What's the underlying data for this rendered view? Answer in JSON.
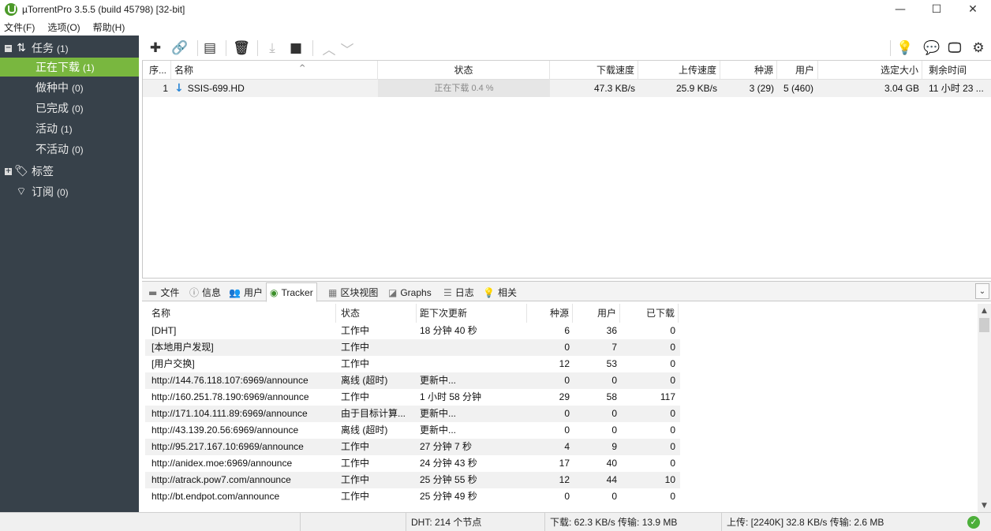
{
  "window": {
    "title": "µTorrentPro 3.5.5  (build 45798) [32-bit]",
    "minimize_icon": "minimize-icon",
    "maximize_icon": "maximize-icon",
    "close_icon": "close-icon"
  },
  "menu": [
    "文件(F)",
    "选项(O)",
    "帮助(H)"
  ],
  "sidebar": {
    "tasks": {
      "label": "任务",
      "count": "(1)"
    },
    "items": [
      {
        "label": "正在下载",
        "count": "(1)"
      },
      {
        "label": "做种中",
        "count": "(0)"
      },
      {
        "label": "已完成",
        "count": "(0)"
      },
      {
        "label": "活动",
        "count": "(1)"
      },
      {
        "label": "不活动",
        "count": "(0)"
      }
    ],
    "labels": {
      "label": "标签"
    },
    "feeds": {
      "label": "订阅",
      "count": "(0)"
    }
  },
  "toolbar": {
    "buttons": [
      "add-torrent-icon",
      "add-link-icon",
      "create-torrent-icon",
      "delete-icon",
      "start-icon",
      "stop-icon",
      "move-up-icon",
      "move-down-icon",
      "bulb-icon",
      "chat-icon",
      "remote-icon",
      "settings-icon"
    ]
  },
  "torrent_list": {
    "columns": [
      "序...",
      "名称",
      "状态",
      "下载速度",
      "上传速度",
      "种源",
      "用户",
      "选定大小",
      "剩余时间"
    ],
    "rows": [
      {
        "index": "1",
        "name": "SSIS-699.HD",
        "status": "正在下载 0.4 %",
        "progress_percent": 0.4,
        "down_speed": "47.3 KB/s",
        "up_speed": "25.9 KB/s",
        "seeds": "3 (29)",
        "peers": "5 (460)",
        "size": "3.04 GB",
        "eta": "11 小时 23 ..."
      }
    ]
  },
  "tabs": [
    {
      "label": "文件",
      "icon": "files-icon"
    },
    {
      "label": "信息",
      "icon": "info-icon"
    },
    {
      "label": "用户",
      "icon": "peers-icon"
    },
    {
      "label": "Tracker",
      "icon": "tracker-icon"
    },
    {
      "label": "区块视图",
      "icon": "pieces-icon"
    },
    {
      "label": "Graphs",
      "icon": "graphs-icon"
    },
    {
      "label": "日志",
      "icon": "log-icon"
    },
    {
      "label": "相关",
      "icon": "related-icon"
    }
  ],
  "active_tab": "Tracker",
  "tracker_list": {
    "columns": [
      "名称",
      "状态",
      "距下次更新",
      "种源",
      "用户",
      "已下载"
    ],
    "rows": [
      {
        "name": "[DHT]",
        "status": "工作中",
        "next": "18 分钟 40 秒",
        "seeds": "6",
        "peers": "36",
        "downloaded": "0"
      },
      {
        "name": "[本地用户发现]",
        "status": "工作中",
        "next": "",
        "seeds": "0",
        "peers": "7",
        "downloaded": "0"
      },
      {
        "name": "[用户交换]",
        "status": "工作中",
        "next": "",
        "seeds": "12",
        "peers": "53",
        "downloaded": "0"
      },
      {
        "name": "http://144.76.118.107:6969/announce",
        "status": "离线 (超时)",
        "next": "更新中...",
        "seeds": "0",
        "peers": "0",
        "downloaded": "0"
      },
      {
        "name": "http://160.251.78.190:6969/announce",
        "status": "工作中",
        "next": "1 小时 58 分钟",
        "seeds": "29",
        "peers": "58",
        "downloaded": "117"
      },
      {
        "name": "http://171.104.111.89:6969/announce",
        "status": "由于目标计算...",
        "next": "更新中...",
        "seeds": "0",
        "peers": "0",
        "downloaded": "0"
      },
      {
        "name": "http://43.139.20.56:6969/announce",
        "status": "离线 (超时)",
        "next": "更新中...",
        "seeds": "0",
        "peers": "0",
        "downloaded": "0"
      },
      {
        "name": "http://95.217.167.10:6969/announce",
        "status": "工作中",
        "next": "27 分钟 7 秒",
        "seeds": "4",
        "peers": "9",
        "downloaded": "0"
      },
      {
        "name": "http://anidex.moe:6969/announce",
        "status": "工作中",
        "next": "24 分钟 43 秒",
        "seeds": "17",
        "peers": "40",
        "downloaded": "0"
      },
      {
        "name": "http://atrack.pow7.com/announce",
        "status": "工作中",
        "next": "25 分钟 55 秒",
        "seeds": "12",
        "peers": "44",
        "downloaded": "10"
      },
      {
        "name": "http://bt.endpot.com/announce",
        "status": "工作中",
        "next": "25 分钟 49 秒",
        "seeds": "0",
        "peers": "0",
        "downloaded": "0"
      }
    ]
  },
  "statusbar": {
    "dht": "DHT: 214 个节点",
    "download": "下载: 62.3 KB/s 传输: 13.9 MB",
    "upload": "上传:  [2240K] 32.8 KB/s 传输: 2.6 MB",
    "ok_icon": "connection-ok-icon"
  },
  "colors": {
    "sidebar_bg": "#37414a",
    "sidebar_active": "#79b73f",
    "download_arrow": "#2a86d6",
    "ok_green": "#4caf3a"
  }
}
